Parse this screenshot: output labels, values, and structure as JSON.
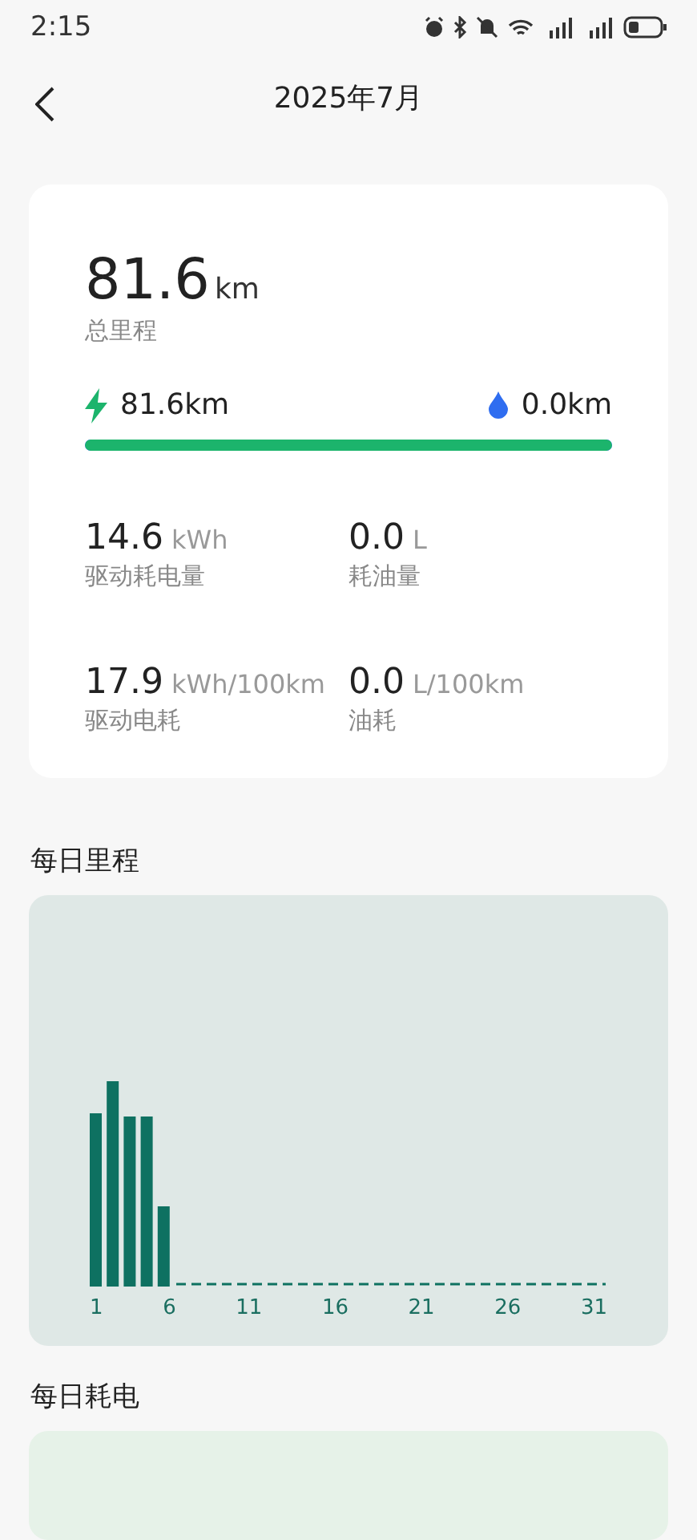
{
  "status_bar": {
    "time": "2:15"
  },
  "header": {
    "title": "2025年7月"
  },
  "summary": {
    "total": {
      "value": "81.6",
      "unit": "km",
      "label": "总里程"
    },
    "electric": {
      "value": "81.6km"
    },
    "fuel": {
      "value": "0.0km"
    },
    "split": {
      "level": 1.0
    },
    "stats": [
      {
        "value": "14.6",
        "unit": "kWh",
        "label": "驱动耗电量"
      },
      {
        "value": "0.0",
        "unit": "L",
        "label": "耗油量"
      },
      {
        "value": "17.9",
        "unit": "kWh/100km",
        "label": "驱动电耗"
      },
      {
        "value": "0.0",
        "unit": "L/100km",
        "label": "油耗"
      }
    ]
  },
  "daily_mileage": {
    "title": "每日里程",
    "x_labels": [
      "1",
      "6",
      "11",
      "16",
      "21",
      "26",
      "31"
    ]
  },
  "daily_energy": {
    "title": "每日耗电"
  }
}
